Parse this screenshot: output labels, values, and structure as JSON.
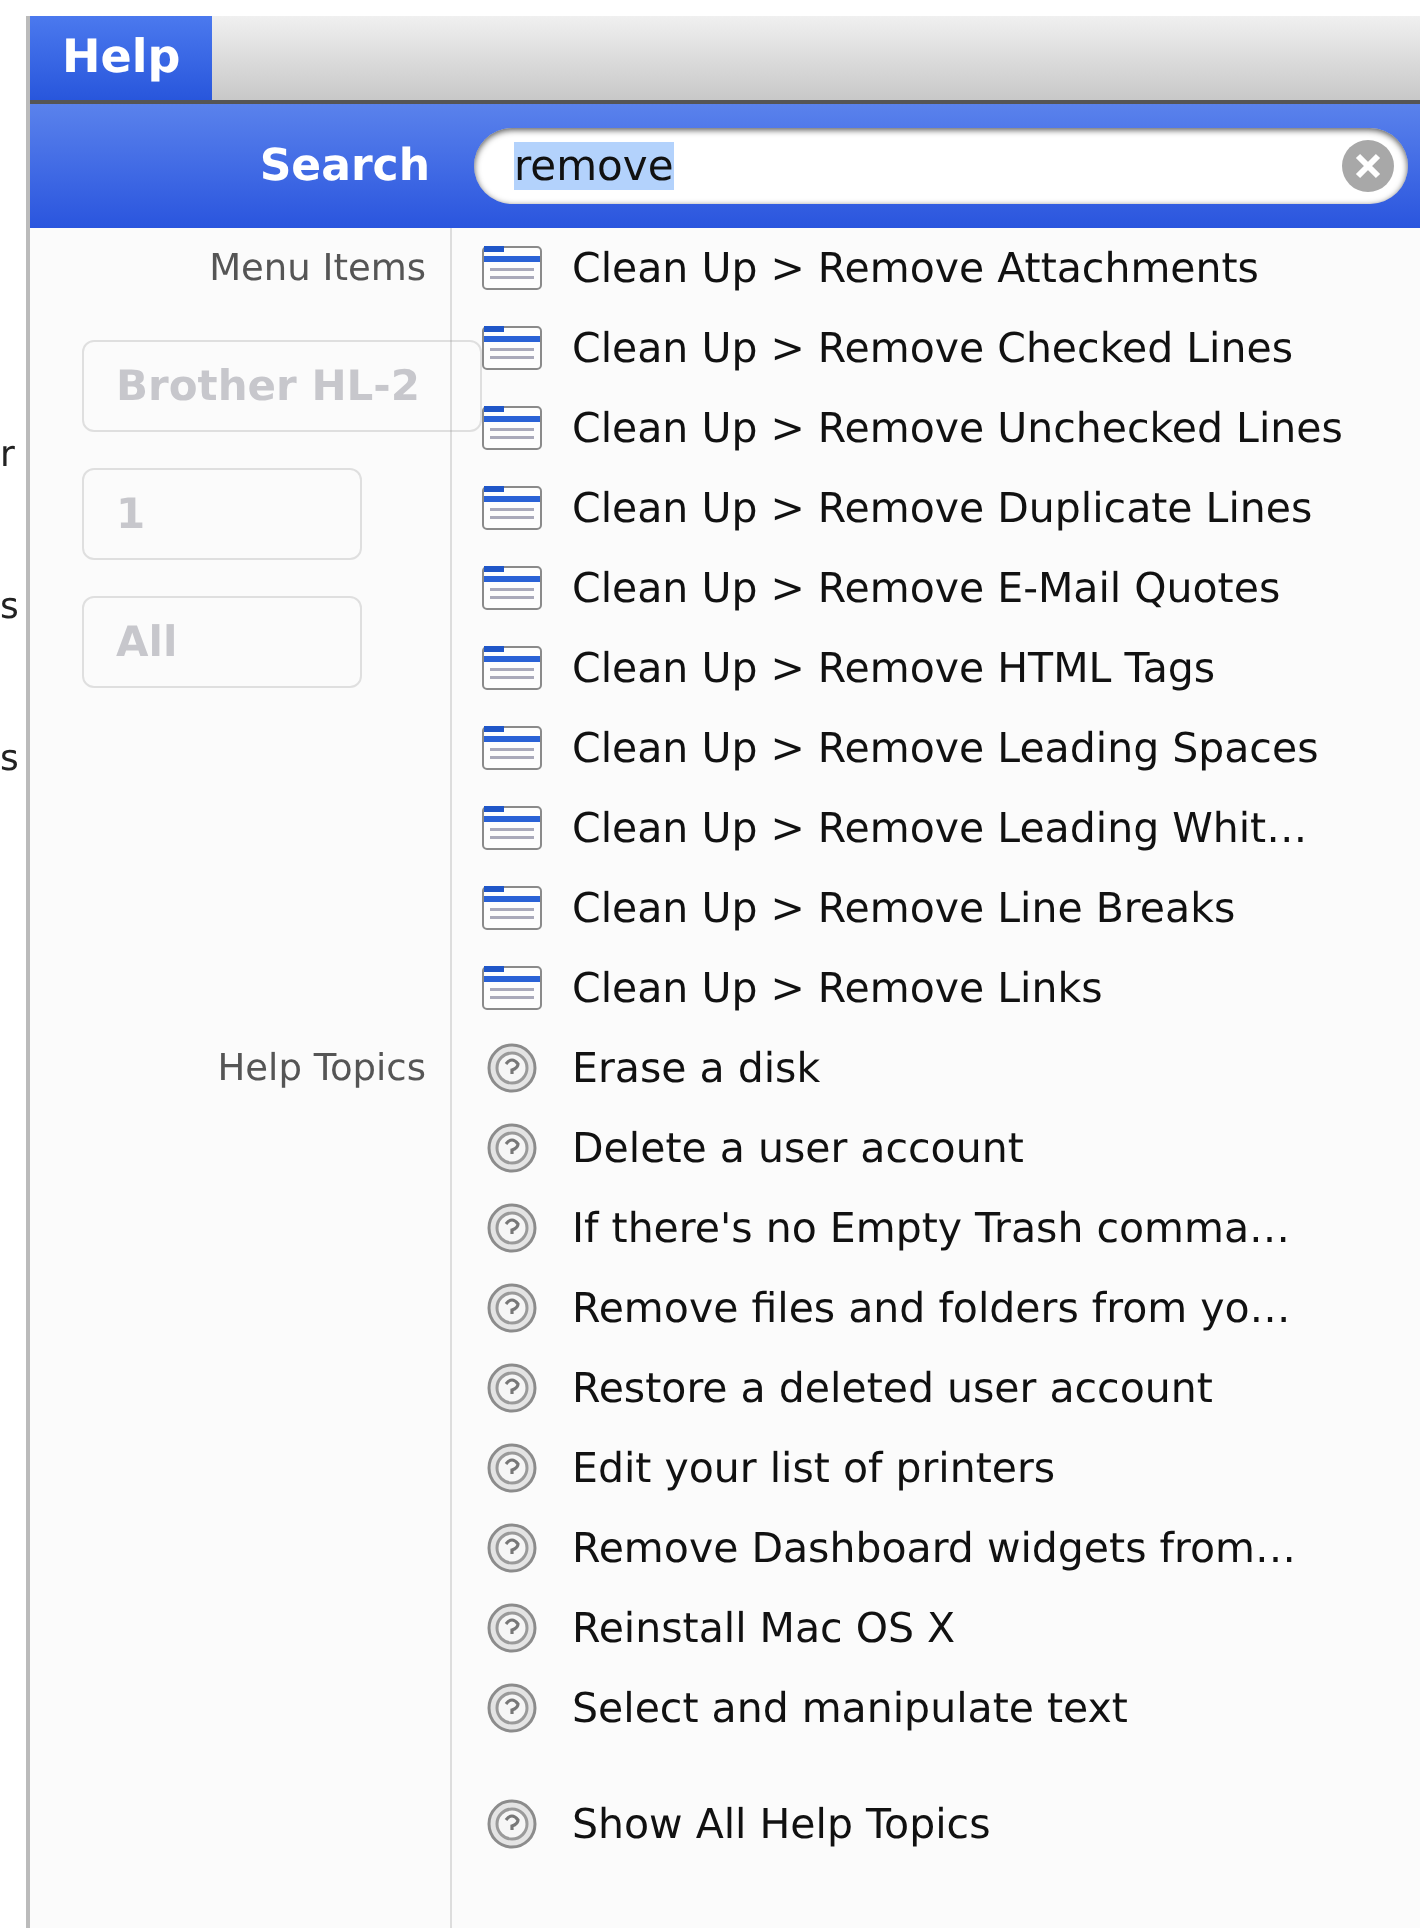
{
  "menu_bar": {
    "menu": {
      "label": "Help",
      "selected": true
    }
  },
  "search": {
    "label": "Search",
    "value": "remove",
    "text_selected": true
  },
  "background_window": {
    "edge_letters": [
      "r",
      "s",
      "s"
    ],
    "printer_popup": "Brother HL-2",
    "copies_field": "1",
    "pages_popup": "All"
  },
  "sections": [
    {
      "heading": "Menu Items",
      "kind": "menu",
      "items": [
        {
          "label": "Clean Up > Remove Attachments"
        },
        {
          "label": "Clean Up > Remove Checked Lines"
        },
        {
          "label": "Clean Up > Remove Unchecked Lines"
        },
        {
          "label": "Clean Up > Remove Duplicate Lines"
        },
        {
          "label": "Clean Up > Remove E-Mail Quotes"
        },
        {
          "label": "Clean Up > Remove HTML Tags"
        },
        {
          "label": "Clean Up > Remove Leading Spaces"
        },
        {
          "label": "Clean Up > Remove Leading Whit…"
        },
        {
          "label": "Clean Up > Remove Line Breaks"
        },
        {
          "label": "Clean Up > Remove Links"
        }
      ]
    },
    {
      "heading": "Help Topics",
      "kind": "topic",
      "items": [
        {
          "label": "Erase a disk"
        },
        {
          "label": "Delete a user account"
        },
        {
          "label": "If there's no Empty Trash comma…"
        },
        {
          "label": "Remove files and folders from yo…"
        },
        {
          "label": "Restore a deleted user account"
        },
        {
          "label": "Edit your list of printers"
        },
        {
          "label": "Remove Dashboard widgets from…"
        },
        {
          "label": "Reinstall Mac OS X"
        },
        {
          "label": "Select and manipulate text"
        }
      ]
    }
  ],
  "footer": {
    "label": "Show All Help Topics",
    "kind": "topic"
  }
}
